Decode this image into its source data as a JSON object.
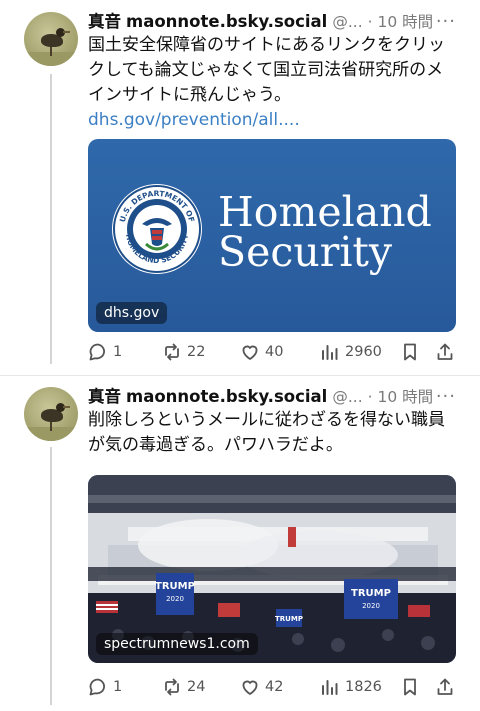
{
  "posts": [
    {
      "author": {
        "display_name": "真音",
        "handle": "maonnote.bsky.social",
        "handle_suffix": "@...",
        "time": "· 10 時間"
      },
      "text": "国土安全保障省のサイトにあるリンクをクリックしても論文じゃなくて国立司法省研究所のメインサイトに飛んじゃう。",
      "link": "dhs.gov/prevention/all....",
      "card": {
        "domain": "dhs.gov",
        "wordmark_line1": "Homeland",
        "wordmark_line2": "Security",
        "seal_top_text": "U.S. DEPARTMENT OF",
        "seal_bottom_text": "HOMELAND SECURITY",
        "bg_color": "#2b62a3"
      },
      "stats": {
        "replies": "1",
        "reposts": "22",
        "likes": "40",
        "views": "2960"
      }
    },
    {
      "author": {
        "display_name": "真音",
        "handle": "maonnote.bsky.social",
        "handle_suffix": "@...",
        "time": "· 10 時間"
      },
      "text": "削除しろというメールに従わざるを得ない職員が気の毒過ぎる。パワハラだよ。",
      "card": {
        "domain": "spectrumnews1.com",
        "banners": [
          "TRUMP",
          "TRUMP",
          "TRUMP"
        ],
        "banner_sub": "2020",
        "photo_description": "crowd at the U.S. Capitol west front with Trump flags"
      },
      "stats": {
        "replies": "1",
        "reposts": "24",
        "likes": "42",
        "views": "1826"
      }
    }
  ],
  "icons": {
    "reply": "speech-bubble-icon",
    "repost": "repost-arrows-icon",
    "like": "heart-icon",
    "views": "bar-chart-icon",
    "save": "bookmark-icon",
    "share": "share-arrow-icon",
    "more": "ellipsis-icon"
  },
  "more_label": "···",
  "colors": {
    "link": "#3b7fc4",
    "muted": "#7a7a7a",
    "card_blue": "#2b62a3"
  }
}
